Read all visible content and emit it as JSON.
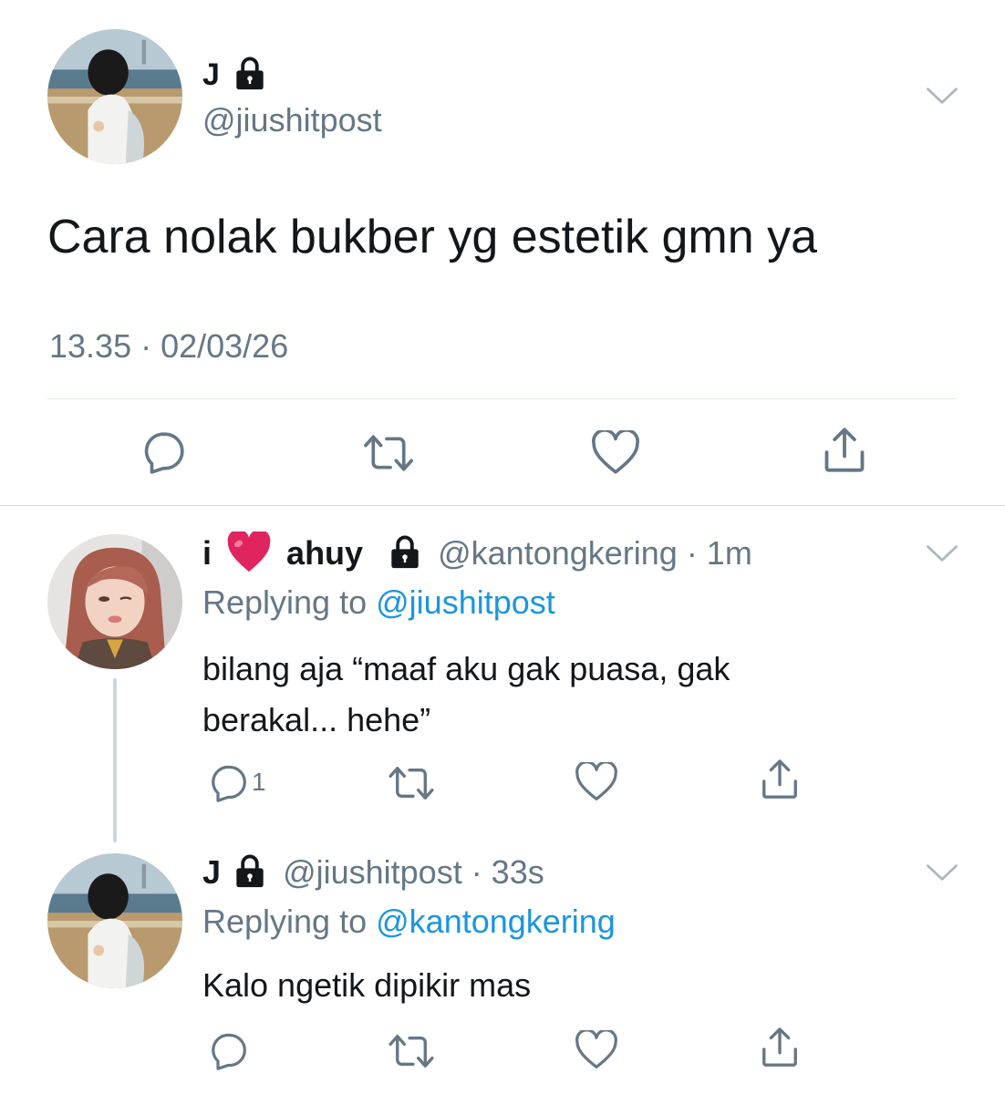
{
  "main_tweet": {
    "name": "J",
    "handle": "@jiushitpost",
    "text": "Cara nolak bukber yg estetik gmn ya",
    "meta": "13.35 · 02/03/26"
  },
  "reply_1": {
    "name_prefix": "i",
    "name_emoji": "❤️",
    "name_suffix": "ahuy",
    "handle_time": "@kantongkering · 1m",
    "replying_label": "Replying to",
    "replying_to": "@jiushitpost",
    "text_line1": "bilang aja “maaf aku gak puasa, gak",
    "text_line2": "berakal... hehe”",
    "reply_count": "1"
  },
  "reply_2": {
    "name": "J",
    "handle_time": "@jiushitpost · 33s",
    "replying_label": "Replying to",
    "replying_to": "@kantongkering",
    "text": "Kalo ngetik dipikir mas"
  },
  "colors": {
    "text": "#14171a",
    "muted": "#657786",
    "link": "#1b95e0",
    "divider": "#e1e8ed",
    "heart": "#e0245e"
  },
  "icons": [
    "lock-icon",
    "chevron-down-icon",
    "reply-icon",
    "retweet-icon",
    "like-icon",
    "share-icon",
    "heart-emoji"
  ]
}
